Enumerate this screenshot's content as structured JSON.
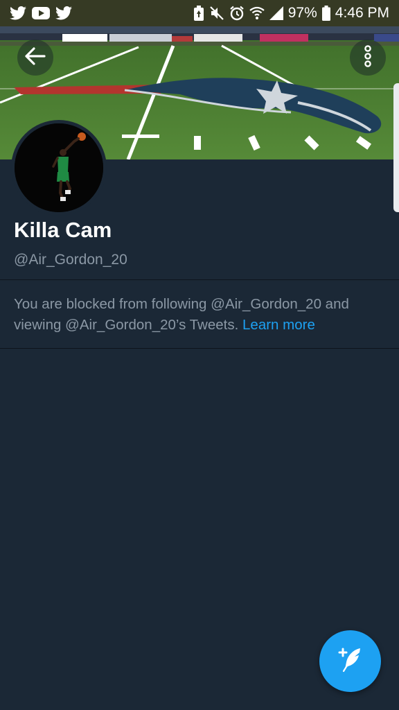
{
  "status_bar": {
    "left_icons": [
      "twitter-icon",
      "youtube-icon",
      "twitter-icon"
    ],
    "right_icons": [
      "battery-saver-icon",
      "mute-icon",
      "alarm-icon",
      "wifi-icon",
      "signal-icon"
    ],
    "battery": "97%",
    "time": "4:46 PM"
  },
  "header": {
    "back_icon": "back-arrow-icon",
    "more_icon": "more-vertical-icon"
  },
  "profile": {
    "display_name": "Killa Cam",
    "handle": "@Air_Gordon_20"
  },
  "blocked_notice": {
    "message": "You are blocked from following @Air_Gordon_20 and viewing @Air_Gordon_20’s Tweets.",
    "link_text": "Learn more"
  },
  "fab": {
    "icon": "compose-tweet-icon"
  },
  "colors": {
    "background": "#1b2836",
    "accent": "#1da1f2",
    "secondary_text": "#8b98a5",
    "status_bar": "#363a24"
  }
}
